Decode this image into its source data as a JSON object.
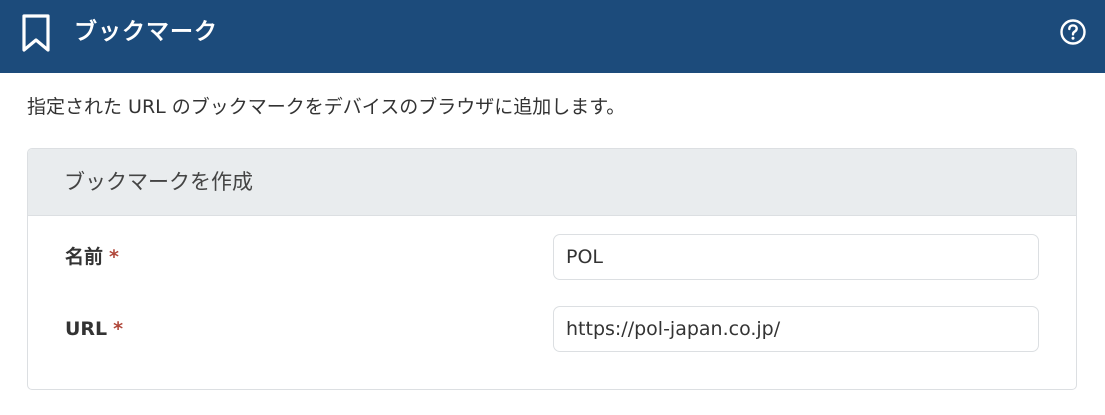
{
  "header": {
    "title": "ブックマーク",
    "bookmark_icon": "bookmark-icon",
    "help_icon": "help-icon",
    "background_color": "#1c4b7b"
  },
  "description": "指定された URL のブックマークをデバイスのブラウザに追加します。",
  "card": {
    "title": "ブックマークを作成",
    "fields": [
      {
        "label": "名前",
        "required_mark": "*",
        "value": "POL"
      },
      {
        "label": "URL",
        "required_mark": "*",
        "value": "https://pol-japan.co.jp/"
      }
    ]
  },
  "colors": {
    "required_mark": "#b0473a",
    "card_header_bg": "#e9ecee"
  }
}
